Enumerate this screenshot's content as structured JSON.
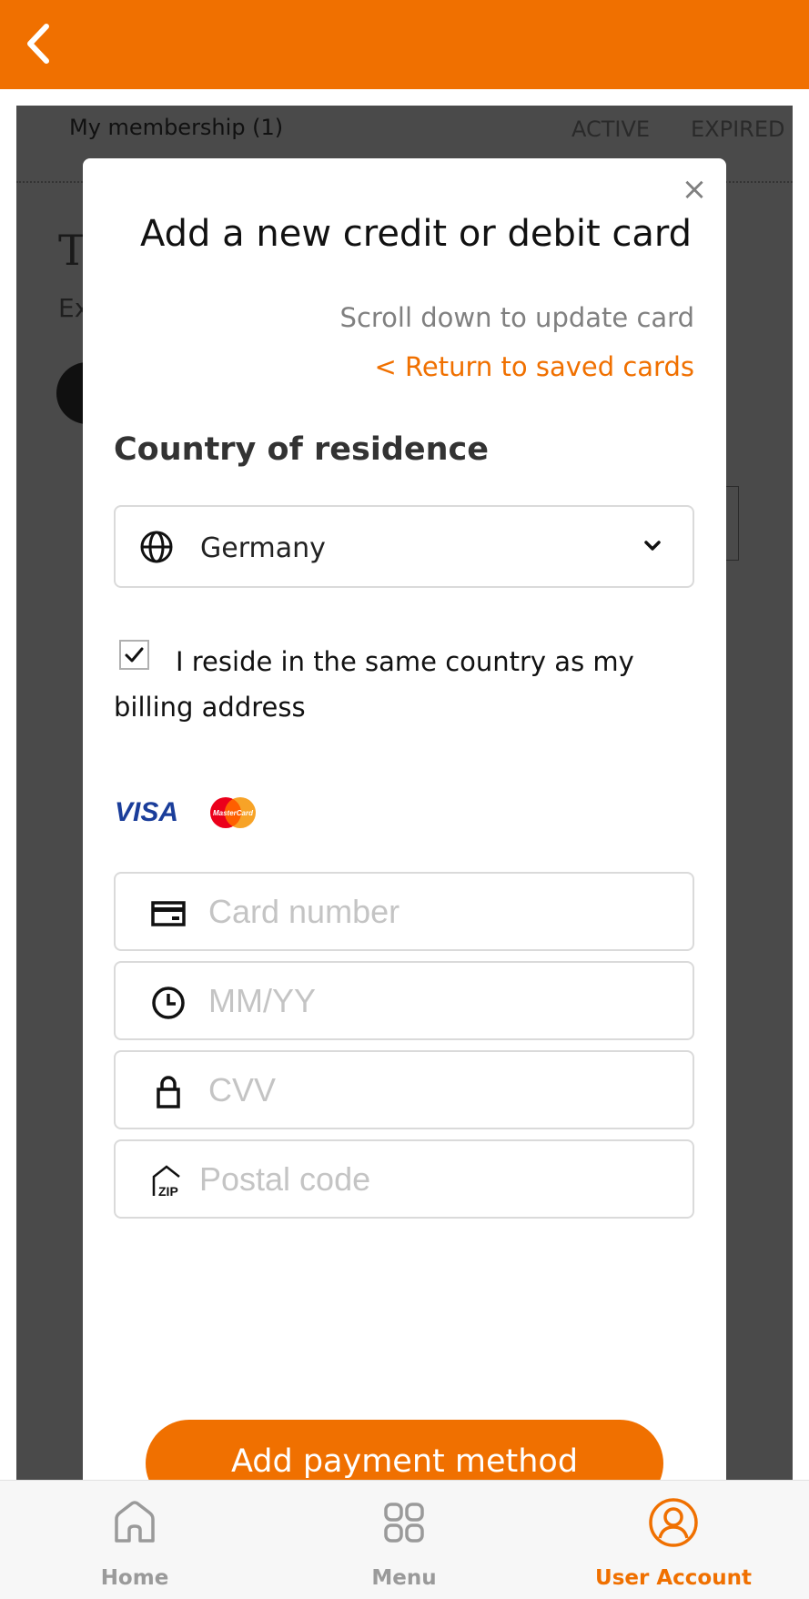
{
  "header": {
    "back_icon": "chevron-left-icon",
    "background_color": "#f07000"
  },
  "background_page": {
    "membership_label": "My membership (1)",
    "tabs": [
      {
        "label": "ACTIVE"
      },
      {
        "label": "EXPIRED"
      }
    ],
    "title_fragment": "T",
    "subtitle_fragment": "Ex"
  },
  "modal": {
    "close_symbol": "×",
    "title": "Add a new credit or debit card",
    "scroll_hint": "Scroll down to update card",
    "return_link": "< Return to saved cards",
    "country_section_title": "Country of residence",
    "country_select": {
      "icon": "globe-icon",
      "value": "Germany",
      "chevron": "chevron-down-icon"
    },
    "same_country_checkbox": {
      "checked": true,
      "label": "I reside in the same country as my billing address"
    },
    "card_brands": [
      {
        "name": "VISA",
        "icon": "visa-logo"
      },
      {
        "name": "MasterCard",
        "icon": "mastercard-logo"
      }
    ],
    "fields": [
      {
        "icon": "credit-card-icon",
        "placeholder": "Card number",
        "value": ""
      },
      {
        "icon": "clock-icon",
        "placeholder": "MM/YY",
        "value": ""
      },
      {
        "icon": "lock-icon",
        "placeholder": "CVV",
        "value": ""
      },
      {
        "icon": "zip-home-icon",
        "placeholder": "Postal code",
        "value": ""
      }
    ],
    "submit_label": "Add payment method"
  },
  "bottom_nav": {
    "items": [
      {
        "label": "Home",
        "icon": "home-icon",
        "active": false
      },
      {
        "label": "Menu",
        "icon": "grid-icon",
        "active": false
      },
      {
        "label": "User Account",
        "icon": "user-icon",
        "active": true
      }
    ]
  },
  "colors": {
    "accent": "#f07000",
    "overlay": "#4a4a4a",
    "placeholder": "#c4c4c4",
    "inactive_nav": "#9a9a9a"
  }
}
